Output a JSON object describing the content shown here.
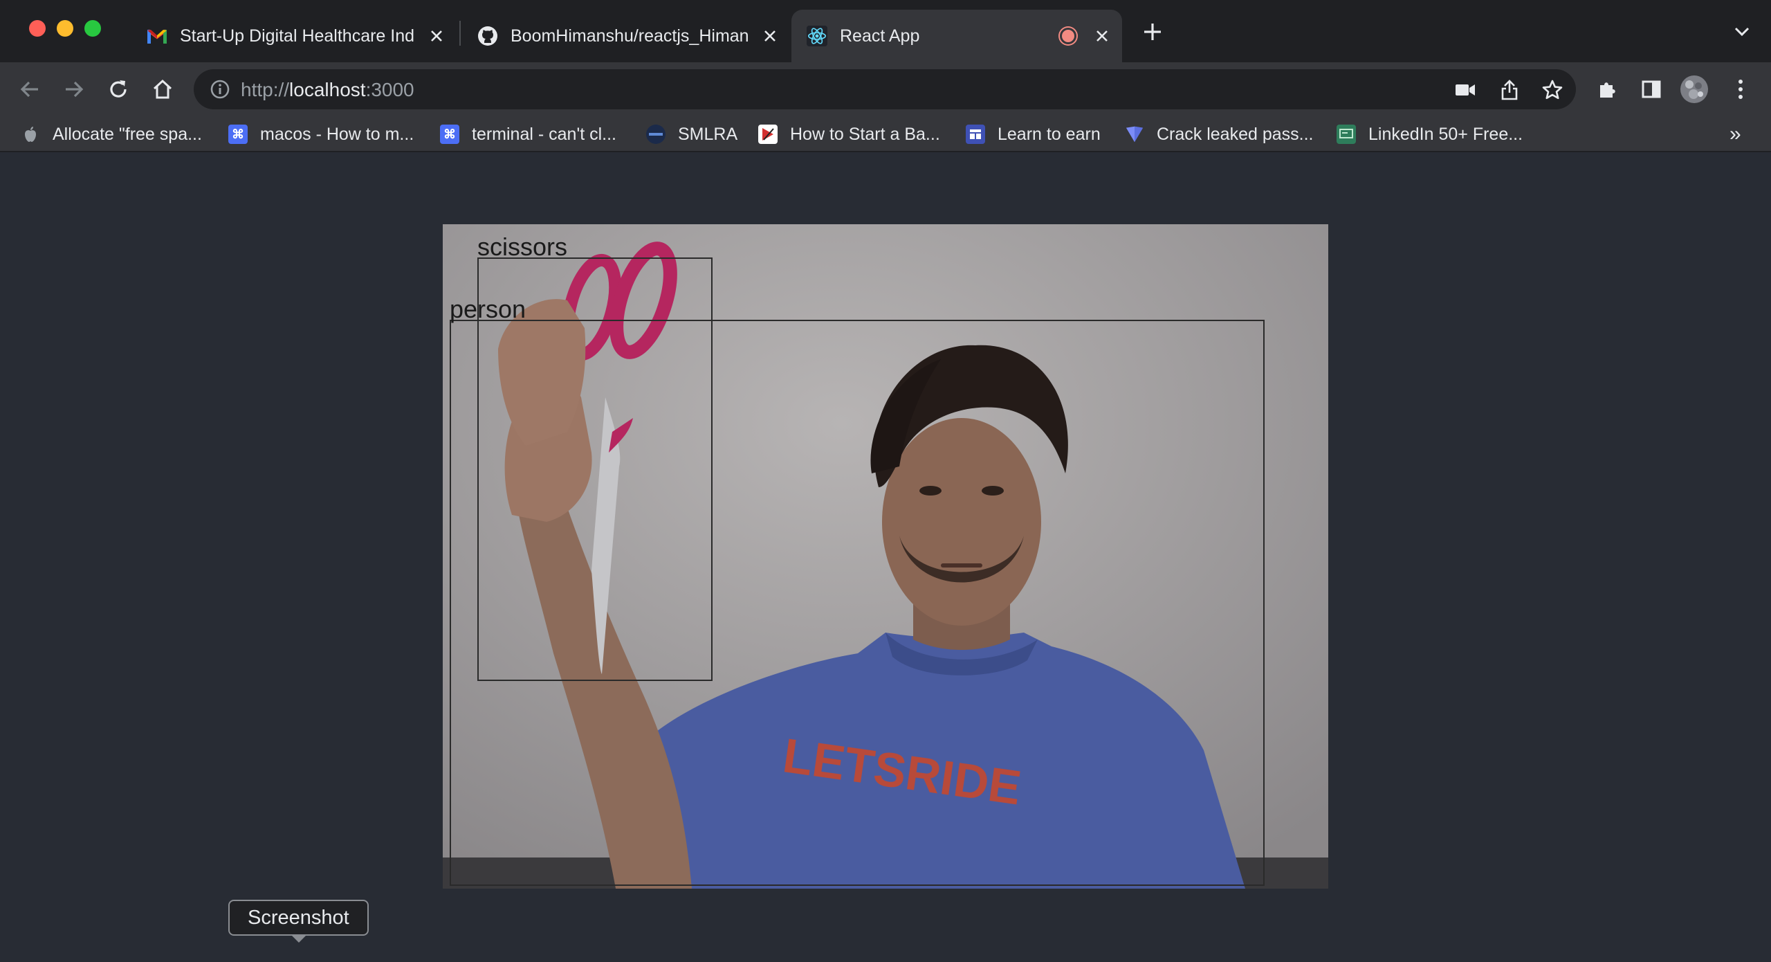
{
  "tabs": [
    {
      "title": "Start-Up Digital Healthcare Ind",
      "favicon": "gmail-icon"
    },
    {
      "title": "BoomHimanshu/reactjs_Himan",
      "favicon": "github-icon"
    },
    {
      "title": "React App",
      "favicon": "react-icon",
      "recording": true
    }
  ],
  "address_bar": {
    "scheme": "http://",
    "host": "localhost",
    "port": ":3000"
  },
  "bookmarks": [
    {
      "label": "Allocate \"free spa...",
      "icon": "apple-icon"
    },
    {
      "label": "macos - How to m...",
      "icon": "command-icon"
    },
    {
      "label": "terminal - can't cl...",
      "icon": "command-icon"
    },
    {
      "label": "SMLRA",
      "icon": "smlra-icon"
    },
    {
      "label": "How to Start a Ba...",
      "icon": "flag-icon"
    },
    {
      "label": "Learn to earn",
      "icon": "layout-icon"
    },
    {
      "label": "Crack leaked pass...",
      "icon": "shield-icon"
    },
    {
      "label": "LinkedIn 50+ Free...",
      "icon": "certificate-icon"
    }
  ],
  "detections": [
    {
      "label": "scissors"
    },
    {
      "label": "person"
    }
  ],
  "tooltip": "Screenshot",
  "colors": {
    "page_background": "#282c34",
    "tab_strip": "#1f2023",
    "toolbar": "#35363a",
    "recording_dot": "#f28b82"
  }
}
